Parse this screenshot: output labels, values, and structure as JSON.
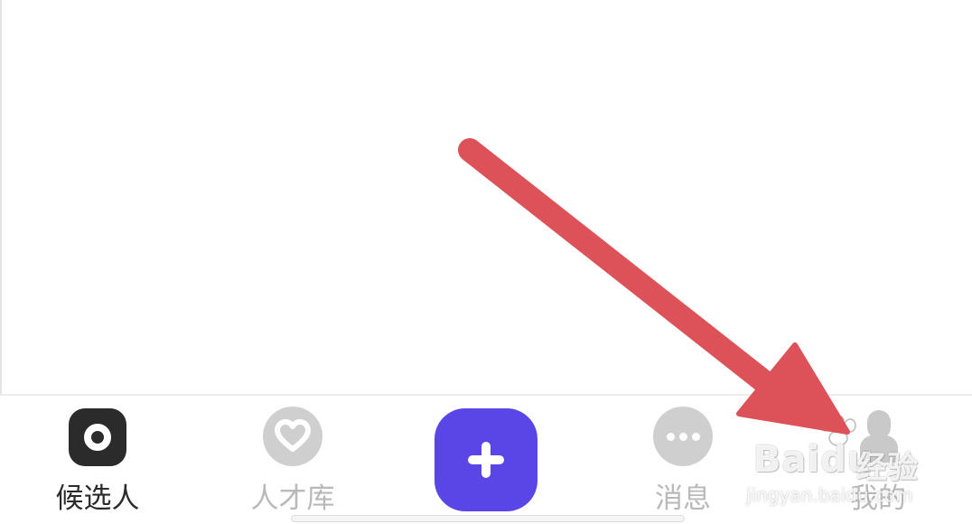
{
  "tab_bar": {
    "tabs": [
      {
        "label": "候选人",
        "state": "active",
        "icon": "candidates-icon"
      },
      {
        "label": "人才库",
        "state": "inactive",
        "icon": "heart-icon"
      },
      {
        "label": "",
        "state": "primary-action",
        "icon": "plus-icon"
      },
      {
        "label": "消息",
        "state": "inactive",
        "icon": "chat-bubble-icon"
      },
      {
        "label": "我的",
        "state": "inactive",
        "icon": "person-icon"
      }
    ]
  },
  "annotation": {
    "type": "arrow",
    "color": "#dc5258",
    "points_to": "tab-mine"
  },
  "watermark": {
    "brand": "Baidu",
    "sub": "经验",
    "url": "jingyan.baidu.com"
  },
  "colors": {
    "active_text": "#2b2b2b",
    "inactive_text": "#b9b9b9",
    "inactive_icon": "#cfcfcf",
    "primary_button": "#5a45e6",
    "arrow": "#dc5258"
  }
}
